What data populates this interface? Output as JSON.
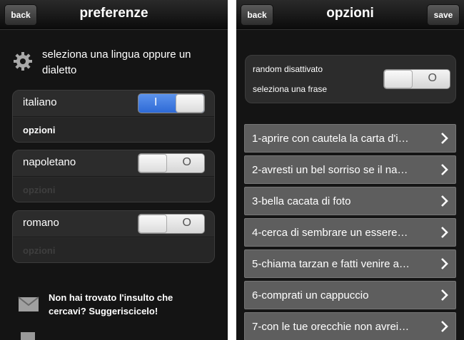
{
  "left": {
    "nav": {
      "back": "back",
      "title": "preferenze"
    },
    "intro": "seleziona una lingua oppure un dialetto",
    "languages": [
      {
        "name": "italiano",
        "toggle_glyph": "I",
        "options": "opzioni"
      },
      {
        "name": "napoletano",
        "toggle_glyph": "O",
        "options": "opzioni"
      },
      {
        "name": "romano",
        "toggle_glyph": "O",
        "options": "opzioni"
      }
    ],
    "suggest": "Non hai trovato l'insulto che cercavi? Suggeriscicelo!"
  },
  "right": {
    "nav": {
      "back": "back",
      "title": "opzioni",
      "save": "save"
    },
    "random": {
      "line1": "random disattivato",
      "line2": "seleziona una frase",
      "toggle_glyph": "O"
    },
    "phrases": [
      "1-aprire con cautela la carta d'i…",
      "2-avresti un bel sorriso se il na…",
      "3-bella cacata di foto",
      "4-cerca di sembrare un essere…",
      "5-chiama tarzan e fatti venire a…",
      "6-comprati un cappuccio",
      "7-con le tue orecchie non avrei…"
    ]
  },
  "colors": {
    "toggle_on": "#2e6ad6",
    "background": "#141414",
    "list_item": "#5e5e5e"
  }
}
